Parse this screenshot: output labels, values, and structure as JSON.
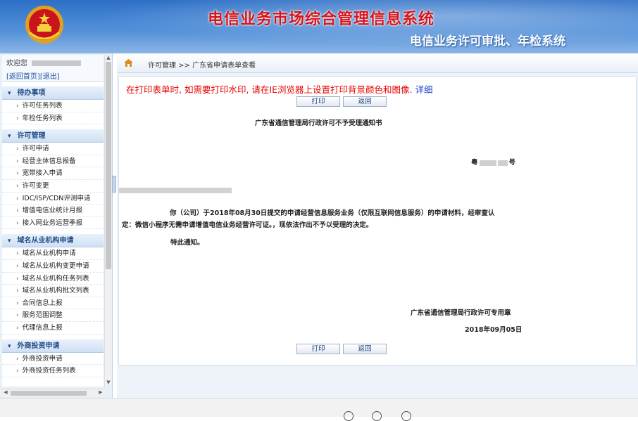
{
  "header": {
    "title": "电信业务市场综合管理信息系统",
    "subtitle": "电信业务许可审批、年检系统"
  },
  "sidebar": {
    "welcome_label": "欢迎您",
    "home_link": "[返回首页]",
    "logout_link": "[退出]",
    "sections": [
      {
        "title": "待办事项",
        "items": [
          "许可任务列表",
          "年检任务列表"
        ]
      },
      {
        "title": "许可管理",
        "items": [
          "许可申请",
          "经营主体信息报备",
          "宽带接入申请",
          "许可变更",
          "IDC/ISP/CDN评测申请",
          "增值电信业统计月报",
          "接入网业务运营季报"
        ]
      },
      {
        "title": "域名从业机构申请",
        "items": [
          "域名从业机构申请",
          "域名从业机构变更申请",
          "域名从业机构任务列表",
          "域名从业机构批文列表",
          "合同信息上报",
          "服务范围调整",
          "代理信息上报"
        ]
      },
      {
        "title": "外商投资申请",
        "items": [
          "外商投资申请",
          "外商投资任务列表"
        ]
      }
    ]
  },
  "breadcrumb": {
    "text": "许可管理 >> 广东省申请表单查看"
  },
  "content": {
    "notice_text": "在打印表单时, 如需要打印水印, 请在IE浏览器上设置打印背景颜色和图像.",
    "notice_link": "详细",
    "print_label": "打印",
    "back_label": "返回",
    "doc_title": "广东省通信管理局行政许可不予受理通知书",
    "doc_number_prefix": "粤",
    "doc_number_suffix": "号",
    "body_line1": "你（公司）于2018年08月30日提交的申请经营信息服务业务（仅限互联网信息服务）的申请材料，经审查认",
    "body_line2": "定：微信小程序无需申请增值电信业务经营许可证。，现依法作出不予以受理的决定。",
    "closing": "特此通知。",
    "seal": "广东省通信管理局行政许可专用章",
    "date": "2018年09月05日"
  },
  "colors": {
    "title_red": "#d8141b",
    "notice_red": "#e60000",
    "link_blue": "#1c3fd0",
    "header_blue": "#2d6fc6"
  }
}
